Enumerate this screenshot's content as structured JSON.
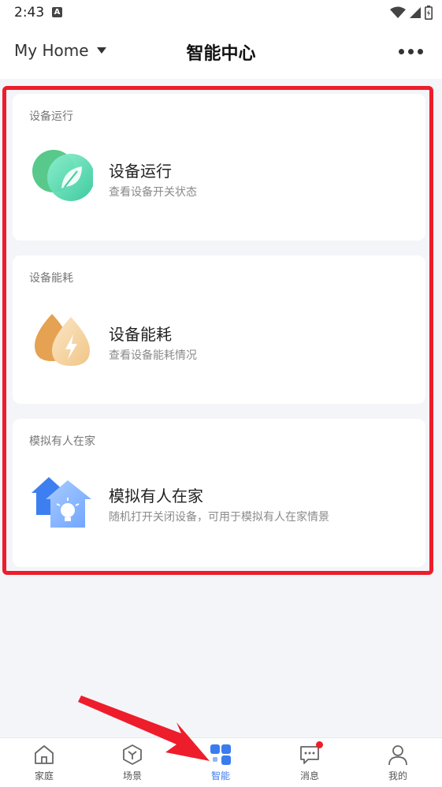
{
  "status_bar": {
    "time": "2:43",
    "notification_letter": "A"
  },
  "header": {
    "home_name": "My Home",
    "title": "智能中心"
  },
  "cards": [
    {
      "section": "设备运行",
      "title": "设备运行",
      "desc": "查看设备开关状态",
      "icon": "leaf-icon"
    },
    {
      "section": "设备能耗",
      "title": "设备能耗",
      "desc": "查看设备能耗情况",
      "icon": "energy-drop-icon"
    },
    {
      "section": "模拟有人在家",
      "title": "模拟有人在家",
      "desc": "随机打开关闭设备，可用于模拟有人在家情景",
      "icon": "house-bulb-icon"
    }
  ],
  "nav": [
    {
      "label": "家庭",
      "icon": "home-icon",
      "active": false
    },
    {
      "label": "场景",
      "icon": "scene-icon",
      "active": false
    },
    {
      "label": "智能",
      "icon": "smart-grid-icon",
      "active": true
    },
    {
      "label": "消息",
      "icon": "message-icon",
      "active": false
    },
    {
      "label": "我的",
      "icon": "profile-icon",
      "active": false
    }
  ],
  "colors": {
    "accent": "#3a7bf0",
    "highlight": "#ee1d2b",
    "background": "#f4f5f9"
  }
}
